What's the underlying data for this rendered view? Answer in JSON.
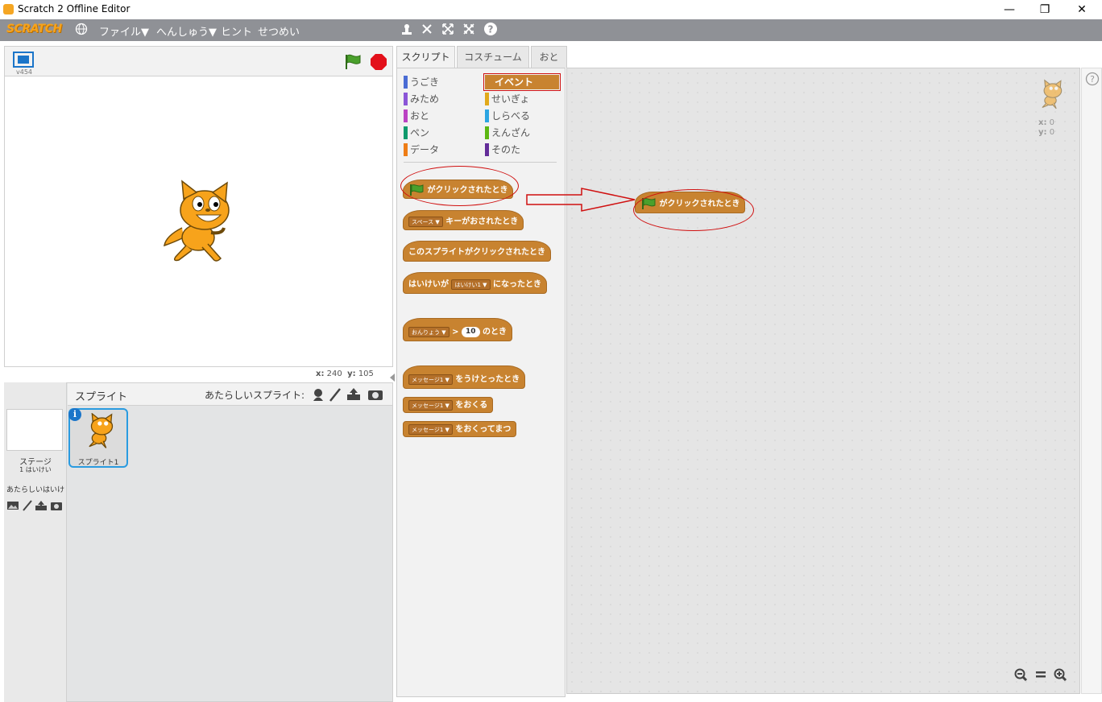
{
  "window": {
    "title": "Scratch 2 Offline Editor",
    "minimize": "—",
    "maximize": "❐",
    "close": "✕"
  },
  "menubar": {
    "logo": "SCRATCH",
    "globe_icon": "globe-icon",
    "items": [
      "ファイル▼",
      "へんしゅう▼",
      "ヒント",
      "せつめい"
    ],
    "tools": [
      "duplicate-icon",
      "delete-icon",
      "grow-icon",
      "shrink-icon",
      "help-icon"
    ]
  },
  "stage": {
    "version": "v454",
    "coords": {
      "x_label": "x:",
      "x_value": "240",
      "y_label": "y:",
      "y_value": "105"
    }
  },
  "sprites": {
    "header": "スプライト",
    "new_sprite_label": "あたらしいスプライト:",
    "stage_label": "ステージ",
    "stage_sub": "1 はいけい",
    "new_backdrop_label": "あたらしいはいけ",
    "sprite1": "スプライト1"
  },
  "tabs": [
    "スクリプト",
    "コスチューム",
    "おと"
  ],
  "categories": {
    "left": [
      {
        "label": "うごき",
        "color": "#4a6cd4"
      },
      {
        "label": "みため",
        "color": "#8a55d7"
      },
      {
        "label": "おと",
        "color": "#bb42c3"
      },
      {
        "label": "ペン",
        "color": "#0e9a6c"
      },
      {
        "label": "データ",
        "color": "#ee7d16"
      }
    ],
    "right": [
      {
        "label": "イベント",
        "color": "#c88330"
      },
      {
        "label": "せいぎょ",
        "color": "#e1a91a"
      },
      {
        "label": "しらべる",
        "color": "#2ca5e2"
      },
      {
        "label": "えんざん",
        "color": "#5cb712"
      },
      {
        "label": "そのた",
        "color": "#632d99"
      }
    ]
  },
  "blocks": {
    "flag_clicked": "がクリックされたとき",
    "key_dropdown": "スペース",
    "key_pressed": "キーがおされたとき",
    "sprite_clicked": "このスプライトがクリックされたとき",
    "backdrop_prefix": "はいけいが",
    "backdrop_dropdown": "はいけい1",
    "backdrop_suffix": "になったとき",
    "sensor_dropdown": "おんりょう",
    "gt": ">",
    "sensor_value": "10",
    "sensor_suffix": "のとき",
    "msg_dropdown": "メッセージ1",
    "receive": "をうけとったとき",
    "broadcast": "をおくる",
    "broadcast_wait": "をおくってまつ"
  },
  "script_area": {
    "sprite_x_label": "x:",
    "sprite_x": "0",
    "sprite_y_label": "y:",
    "sprite_y": "0",
    "placed_block": "がクリックされたとき",
    "zoom": [
      "zoom-out-icon",
      "zoom-reset-icon",
      "zoom-in-icon"
    ]
  },
  "colors": {
    "event": "#c88330",
    "menubar": "#8f9196",
    "highlight": "#d01010"
  }
}
